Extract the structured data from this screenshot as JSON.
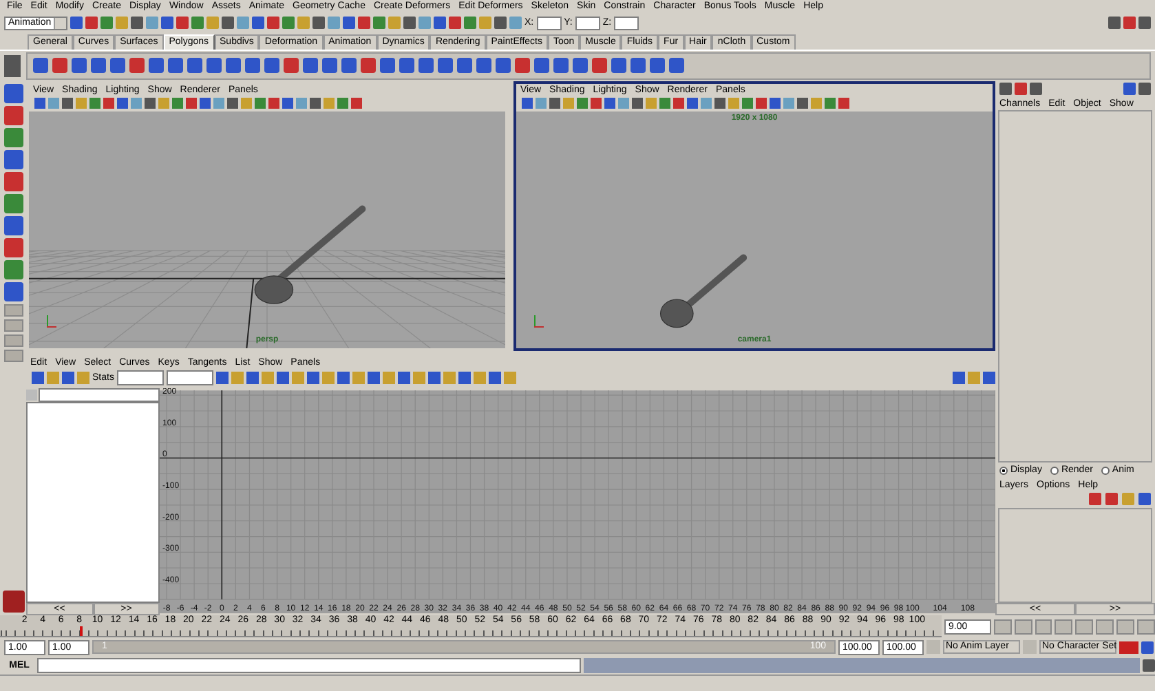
{
  "menu_bar": [
    "File",
    "Edit",
    "Modify",
    "Create",
    "Display",
    "Window",
    "Assets",
    "Animate",
    "Geometry Cache",
    "Create Deformers",
    "Edit Deformers",
    "Skeleton",
    "Skin",
    "Constrain",
    "Character",
    "Bonus Tools",
    "Muscle",
    "Help"
  ],
  "status_line": {
    "mode": "Animation",
    "x_label": "X:",
    "y_label": "Y:",
    "z_label": "Z:"
  },
  "shelf_tabs": [
    {
      "label": "General",
      "selected": false
    },
    {
      "label": "Curves",
      "selected": false
    },
    {
      "label": "Surfaces",
      "selected": false
    },
    {
      "label": "Polygons",
      "selected": true
    },
    {
      "label": "Subdivs",
      "selected": false
    },
    {
      "label": "Deformation",
      "selected": false
    },
    {
      "label": "Animation",
      "selected": false
    },
    {
      "label": "Dynamics",
      "selected": false
    },
    {
      "label": "Rendering",
      "selected": false
    },
    {
      "label": "PaintEffects",
      "selected": false
    },
    {
      "label": "Toon",
      "selected": false
    },
    {
      "label": "Muscle",
      "selected": false
    },
    {
      "label": "Fluids",
      "selected": false
    },
    {
      "label": "Fur",
      "selected": false
    },
    {
      "label": "Hair",
      "selected": false
    },
    {
      "label": "nCloth",
      "selected": false
    },
    {
      "label": "Custom",
      "selected": false
    }
  ],
  "viewports": [
    {
      "menu": [
        "View",
        "Shading",
        "Lighting",
        "Show",
        "Renderer",
        "Panels"
      ],
      "camera": "persp",
      "kind": "perspective",
      "selected": false
    },
    {
      "menu": [
        "View",
        "Shading",
        "Lighting",
        "Show",
        "Renderer",
        "Panels"
      ],
      "camera": "camera1",
      "resolution": "1920 x 1080",
      "kind": "camera",
      "selected": true
    }
  ],
  "channel_box": {
    "menu": [
      "Channels",
      "Edit",
      "Object",
      "Show"
    ]
  },
  "graph_editor": {
    "menu": [
      "Edit",
      "View",
      "Select",
      "Curves",
      "Keys",
      "Tangents",
      "List",
      "Show",
      "Panels"
    ],
    "stats_label": "Stats",
    "scroll_buttons": [
      "<<",
      ">>"
    ],
    "chart_data": {
      "type": "line",
      "grid": true,
      "xlim": [
        -9,
        112
      ],
      "ylim": [
        -450,
        215
      ],
      "xticks": [
        -8,
        -6,
        -4,
        -2,
        0,
        2,
        4,
        6,
        8,
        10,
        12,
        14,
        16,
        18,
        20,
        22,
        24,
        26,
        28,
        30,
        32,
        34,
        36,
        38,
        40,
        42,
        44,
        46,
        48,
        50,
        52,
        54,
        56,
        58,
        60,
        62,
        64,
        66,
        68,
        70,
        72,
        74,
        76,
        78,
        80,
        82,
        84,
        86,
        88,
        90,
        92,
        94,
        96,
        98,
        100,
        104,
        108
      ],
      "yticks": [
        200,
        100,
        0,
        -100,
        -200,
        -300,
        -400
      ]
    }
  },
  "layer_editor": {
    "modes": [
      {
        "label": "Display",
        "selected": true
      },
      {
        "label": "Render",
        "selected": false
      },
      {
        "label": "Anim",
        "selected": false
      }
    ],
    "menu": [
      "Layers",
      "Options",
      "Help"
    ],
    "scroll_buttons": [
      "<<",
      ">>"
    ]
  },
  "time_slider": {
    "ticks": [
      "2",
      "4",
      "6",
      "8",
      "10",
      "12",
      "14",
      "16",
      "18",
      "20",
      "22",
      "24",
      "26",
      "28",
      "30",
      "32",
      "34",
      "36",
      "38",
      "40",
      "42",
      "44",
      "46",
      "48",
      "50",
      "52",
      "54",
      "56",
      "58",
      "60",
      "62",
      "64",
      "66",
      "68",
      "70",
      "72",
      "74",
      "76",
      "78",
      "80",
      "82",
      "84",
      "86",
      "88",
      "90",
      "92",
      "94",
      "96",
      "98",
      "100"
    ],
    "level": 0.085,
    "current_frame": "9.00"
  },
  "range_slider": {
    "start_time": "1.00",
    "range_start": "1.00",
    "slider_start": "1",
    "slider_end": "100",
    "level": 1,
    "range_end": "100.00",
    "end_time": "100.00",
    "anim_layer": "No Anim Layer",
    "character_set": "No Character Set"
  },
  "command_line": {
    "label": "MEL"
  }
}
